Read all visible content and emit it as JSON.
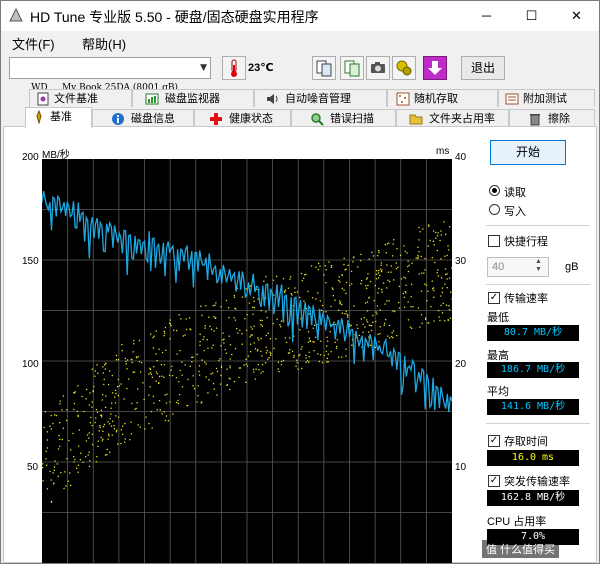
{
  "window": {
    "title": "HD Tune 专业版 5.50 - 硬盘/固态硬盘实用程序"
  },
  "menu": {
    "file": "文件(F)",
    "help": "帮助(H)"
  },
  "toolbar": {
    "drive": "WD     My Book 25DA (8001 gB)",
    "temperature": "23℃",
    "exit": "退出"
  },
  "tabs_top": [
    "文件基准",
    "磁盘监视器",
    "自动噪音管理",
    "随机存取",
    "附加测试"
  ],
  "tabs_bottom": [
    "基准",
    "磁盘信息",
    "健康状态",
    "错误扫描",
    "文件夹占用率",
    "擦除"
  ],
  "chart_data": {
    "type": "line",
    "yleft_label": "MB/秒",
    "yright_label": "ms",
    "yleft_ticks": [
      "200",
      "150",
      "100",
      "50"
    ],
    "yright_ticks": [
      "40",
      "30",
      "20",
      "10"
    ],
    "ylim_left": [
      0,
      200
    ],
    "ylim_right": [
      0,
      40
    ],
    "xlim": [
      0,
      100
    ],
    "grid": true,
    "series": [
      {
        "type": "line",
        "color": "#1ea7e1",
        "x": [
          0,
          5,
          10,
          15,
          20,
          25,
          30,
          35,
          40,
          45,
          50,
          55,
          60,
          65,
          70,
          75,
          80,
          85,
          90,
          95,
          100
        ],
        "values": [
          183,
          178,
          172,
          168,
          163,
          160,
          157,
          153,
          150,
          145,
          140,
          136,
          131,
          126,
          121,
          116,
          110,
          105,
          98,
          90,
          80
        ]
      },
      {
        "type": "scatter",
        "color": "#e8e020",
        "axis": "right",
        "x": [
          0,
          10,
          20,
          30,
          40,
          50,
          60,
          70,
          80,
          90,
          95
        ],
        "values": [
          10,
          14,
          17,
          19,
          21,
          23,
          24,
          25,
          26,
          28,
          29
        ]
      }
    ]
  },
  "panel": {
    "start": "开始",
    "read": "读取",
    "write": "写入",
    "short_stroke": "快捷行程",
    "short_stroke_value": "40",
    "short_stroke_unit": "gB",
    "transfer_rate": "传输速率",
    "min_label": "最低",
    "min_value": "80.7 MB/秒",
    "max_label": "最高",
    "max_value": "186.7 MB/秒",
    "avg_label": "平均",
    "avg_value": "141.6 MB/秒",
    "access_time": "存取时间",
    "access_value": "16.0 ms",
    "burst_rate": "突发传输速率",
    "burst_value": "162.8 MB/秒",
    "cpu_label": "CPU 占用率",
    "cpu_value": "7.0%"
  },
  "watermark": "值 什么值得买"
}
